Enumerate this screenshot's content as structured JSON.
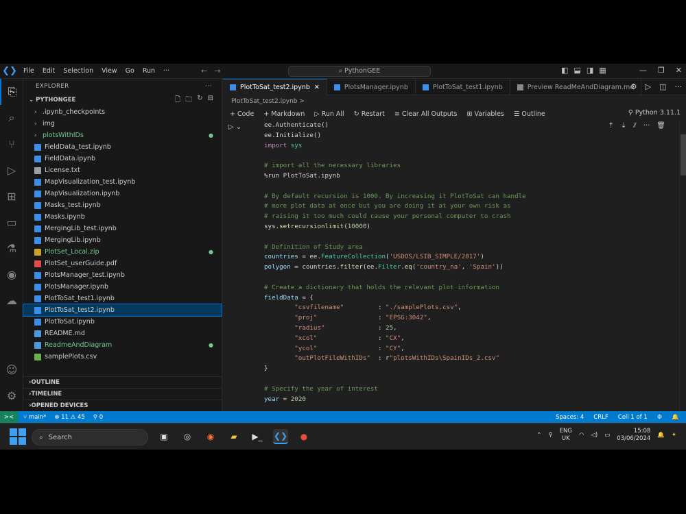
{
  "titlebar": {
    "menu": [
      "File",
      "Edit",
      "Selection",
      "View",
      "Go",
      "Run",
      "···"
    ],
    "search": "PythonGEE"
  },
  "sidebar": {
    "title": "EXPLORER",
    "folder": "PYTHONGEE",
    "items": [
      {
        "label": ".ipynb_checkpoints",
        "type": "folder"
      },
      {
        "label": "img",
        "type": "folder"
      },
      {
        "label": "plotsWithIDs",
        "type": "folder",
        "color": "#73c991"
      },
      {
        "label": "FieldData_test.ipynb",
        "type": "nb"
      },
      {
        "label": "FieldData.ipynb",
        "type": "nb"
      },
      {
        "label": "License.txt",
        "type": "txt"
      },
      {
        "label": "MapVisualization_test.ipynb",
        "type": "nb"
      },
      {
        "label": "MapVisualization.ipynb",
        "type": "nb"
      },
      {
        "label": "Masks_test.ipynb",
        "type": "nb"
      },
      {
        "label": "Masks.ipynb",
        "type": "nb"
      },
      {
        "label": "MergingLib_test.ipynb",
        "type": "nb"
      },
      {
        "label": "MergingLib.ipynb",
        "type": "nb"
      },
      {
        "label": "PlotSet_Local.zip",
        "type": "zip",
        "color": "#73c991"
      },
      {
        "label": "PlotSet_userGuide.pdf",
        "type": "pdf"
      },
      {
        "label": "PlotsManager_test.ipynb",
        "type": "nb"
      },
      {
        "label": "PlotsManager.ipynb",
        "type": "nb"
      },
      {
        "label": "PlotToSat_test1.ipynb",
        "type": "nb"
      },
      {
        "label": "PlotToSat_test2.ipynb",
        "type": "nb",
        "selected": true
      },
      {
        "label": "PlotToSat.ipynb",
        "type": "nb"
      },
      {
        "label": "README.md",
        "type": "md"
      },
      {
        "label": "ReadmeAndDiagram",
        "type": "md",
        "color": "#73c991"
      },
      {
        "label": "samplePlots.csv",
        "type": "csv"
      }
    ],
    "sections": [
      "OUTLINE",
      "TIMELINE",
      "OPENED DEVICES"
    ]
  },
  "tabs": [
    {
      "label": "PlotToSat_test2.ipynb",
      "active": true
    },
    {
      "label": "PlotsManager.ipynb",
      "active": false
    },
    {
      "label": "PlotToSat_test1.ipynb",
      "active": false
    },
    {
      "label": "Preview ReadMeAndDiagram.md",
      "active": false
    }
  ],
  "breadcrumb": "PlotToSat_test2.ipynb >",
  "toolbar": {
    "code": "+ Code",
    "markdown": "+ Markdown",
    "run_all": "Run All",
    "restart": "Restart",
    "clear": "Clear All Outputs",
    "variables": "Variables",
    "outline": "Outline",
    "kernel": "Python 3.11.1"
  },
  "code_lines": [
    [
      {
        "t": "ee.Authenticate()",
        "c": "c-def"
      }
    ],
    [
      {
        "t": "ee.Initialize()",
        "c": "c-def"
      }
    ],
    [
      {
        "t": "import ",
        "c": "c-kw"
      },
      {
        "t": "sys",
        "c": "c-cls"
      }
    ],
    [
      {
        "t": "",
        "c": "c-def"
      }
    ],
    [
      {
        "t": "# import all the necessary libraries",
        "c": "c-com"
      }
    ],
    [
      {
        "t": "%run PlotToSat.ipynb",
        "c": "c-def"
      }
    ],
    [
      {
        "t": "",
        "c": "c-def"
      }
    ],
    [
      {
        "t": "# By default recursion is 1000. By increasing it PlotToSat can handle",
        "c": "c-com"
      }
    ],
    [
      {
        "t": "# more plot data at once but you are doing it at your own risk as",
        "c": "c-com"
      }
    ],
    [
      {
        "t": "# raising it too much could cause your personal computer to crash",
        "c": "c-com"
      }
    ],
    [
      {
        "t": "sys.",
        "c": "c-def"
      },
      {
        "t": "setrecursionlimit",
        "c": "c-fn"
      },
      {
        "t": "(",
        "c": "c-def"
      },
      {
        "t": "10000",
        "c": "c-num"
      },
      {
        "t": ")",
        "c": "c-def"
      }
    ],
    [
      {
        "t": "",
        "c": "c-def"
      }
    ],
    [
      {
        "t": "# Definition of Study area",
        "c": "c-com"
      }
    ],
    [
      {
        "t": "countries",
        "c": "c-var"
      },
      {
        "t": " = ee.",
        "c": "c-def"
      },
      {
        "t": "FeatureCollection",
        "c": "c-cls"
      },
      {
        "t": "(",
        "c": "c-def"
      },
      {
        "t": "'USDOS/LSIB_SIMPLE/2017'",
        "c": "c-str"
      },
      {
        "t": ")",
        "c": "c-def"
      }
    ],
    [
      {
        "t": "polygon",
        "c": "c-var"
      },
      {
        "t": " = countries.",
        "c": "c-def"
      },
      {
        "t": "filter",
        "c": "c-fn"
      },
      {
        "t": "(ee.",
        "c": "c-def"
      },
      {
        "t": "Filter",
        "c": "c-cls"
      },
      {
        "t": ".",
        "c": "c-def"
      },
      {
        "t": "eq",
        "c": "c-fn"
      },
      {
        "t": "(",
        "c": "c-def"
      },
      {
        "t": "'country_na'",
        "c": "c-str"
      },
      {
        "t": ", ",
        "c": "c-def"
      },
      {
        "t": "'Spain'",
        "c": "c-str"
      },
      {
        "t": "))",
        "c": "c-def"
      }
    ],
    [
      {
        "t": "",
        "c": "c-def"
      }
    ],
    [
      {
        "t": "# Create a dictionary that holds the relevant plot information",
        "c": "c-com"
      }
    ],
    [
      {
        "t": "fieldData",
        "c": "c-var"
      },
      {
        "t": " = {",
        "c": "c-def"
      }
    ],
    [
      {
        "t": "        ",
        "c": "c-def"
      },
      {
        "t": "\"csvfilename\"",
        "c": "c-str"
      },
      {
        "t": "         : ",
        "c": "c-def"
      },
      {
        "t": "\"./samplePlots.csv\"",
        "c": "c-str"
      },
      {
        "t": ",",
        "c": "c-def"
      }
    ],
    [
      {
        "t": "        ",
        "c": "c-def"
      },
      {
        "t": "\"proj\"",
        "c": "c-str"
      },
      {
        "t": "                : ",
        "c": "c-def"
      },
      {
        "t": "\"EPSG:3042\"",
        "c": "c-str"
      },
      {
        "t": ",",
        "c": "c-def"
      }
    ],
    [
      {
        "t": "        ",
        "c": "c-def"
      },
      {
        "t": "\"radius\"",
        "c": "c-str"
      },
      {
        "t": "              : ",
        "c": "c-def"
      },
      {
        "t": "25",
        "c": "c-num"
      },
      {
        "t": ",",
        "c": "c-def"
      }
    ],
    [
      {
        "t": "        ",
        "c": "c-def"
      },
      {
        "t": "\"xcol\"",
        "c": "c-str"
      },
      {
        "t": "                : ",
        "c": "c-def"
      },
      {
        "t": "\"CX\"",
        "c": "c-str"
      },
      {
        "t": ",",
        "c": "c-def"
      }
    ],
    [
      {
        "t": "        ",
        "c": "c-def"
      },
      {
        "t": "\"ycol\"",
        "c": "c-str"
      },
      {
        "t": "                : ",
        "c": "c-def"
      },
      {
        "t": "\"CY\"",
        "c": "c-str"
      },
      {
        "t": ",",
        "c": "c-def"
      }
    ],
    [
      {
        "t": "        ",
        "c": "c-def"
      },
      {
        "t": "\"outPlotFileWithIDs\"",
        "c": "c-str"
      },
      {
        "t": "  : r",
        "c": "c-def"
      },
      {
        "t": "\"plotsWithIDs\\SpainIDs_2.csv\"",
        "c": "c-str"
      }
    ],
    [
      {
        "t": "}",
        "c": "c-def"
      }
    ],
    [
      {
        "t": "",
        "c": "c-def"
      }
    ],
    [
      {
        "t": "# Specify the year of interest",
        "c": "c-com"
      }
    ],
    [
      {
        "t": "year",
        "c": "c-var"
      },
      {
        "t": " = ",
        "c": "c-def"
      },
      {
        "t": "2020",
        "c": "c-num"
      }
    ]
  ],
  "status": {
    "remote": "><",
    "branch": "main*",
    "problems": "⊗ 11 ⚠ 45",
    "ports": "⚲ 0",
    "spaces": "Spaces: 4",
    "eol": "CRLF",
    "cell": "Cell 1 of 1"
  },
  "taskbar": {
    "search": "Search",
    "lang1": "ENG",
    "lang2": "UK",
    "time": "15:08",
    "date": "03/06/2024"
  },
  "colors": {
    "accent": "#0078d4",
    "statusbar": "#007acc",
    "editor_bg": "#1f1f1f",
    "sidebar_bg": "#181818"
  }
}
